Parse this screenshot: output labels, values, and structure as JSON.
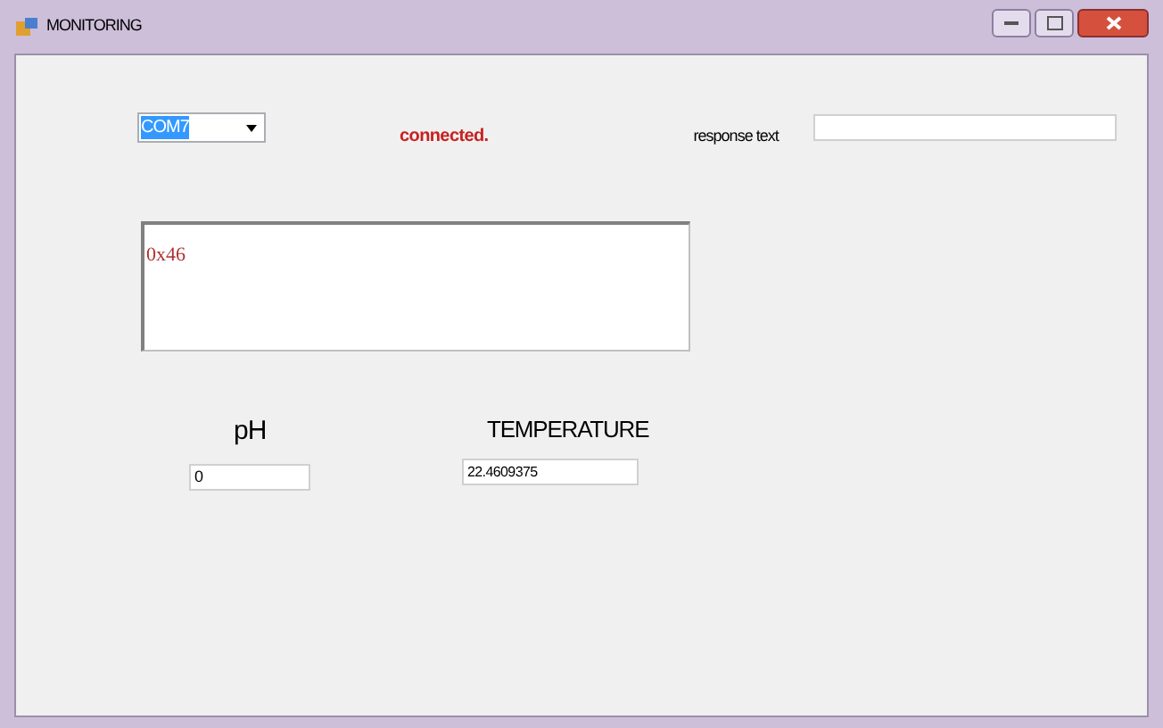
{
  "window": {
    "title": "MONITORING"
  },
  "port_select": {
    "value": "COM7"
  },
  "status": "connected.",
  "response": {
    "label": "response text"
  },
  "log": {
    "value": "0x46"
  },
  "readings": [
    {
      "label": "pH",
      "value": "0"
    },
    {
      "label": "TEMPERATURE",
      "value": "22.4609375"
    }
  ]
}
